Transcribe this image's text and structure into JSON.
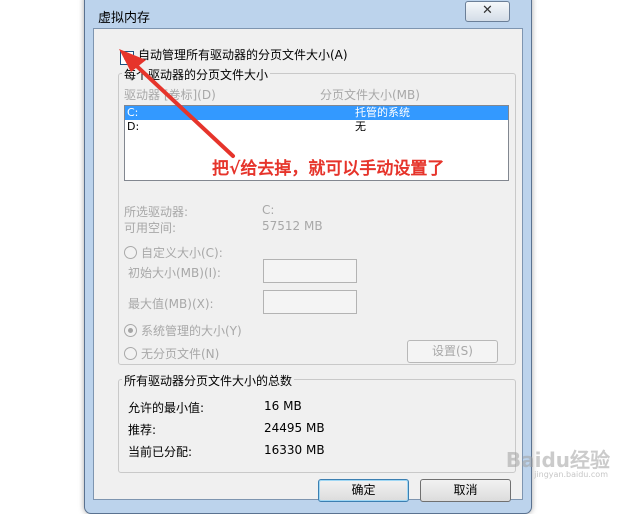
{
  "window": {
    "title": "虚拟内存",
    "close_glyph": "✕"
  },
  "auto_manage": {
    "label": "自动管理所有驱动器的分页文件大小(A)",
    "checked": true,
    "check_glyph": "✓"
  },
  "per_drive": {
    "group_title": "每个驱动器的分页文件大小",
    "col_drive": "驱动器 [卷标](D)",
    "col_size": "分页文件大小(MB)",
    "rows": [
      {
        "drive": "C:",
        "size": "托管的系统",
        "selected": true
      },
      {
        "drive": "D:",
        "size": "无",
        "selected": false
      }
    ],
    "selected_drive_label": "所选驱动器:",
    "selected_drive_value": "C:",
    "free_space_label": "可用空间:",
    "free_space_value": "57512 MB",
    "custom_size_label": "自定义大小(C):",
    "initial_size_label": "初始大小(MB)(I):",
    "max_size_label": "最大值(MB)(X):",
    "system_managed_label": "系统管理的大小(Y)",
    "no_paging_label": "无分页文件(N)",
    "set_button": "设置(S)"
  },
  "totals": {
    "group_title": "所有驱动器分页文件大小的总数",
    "min_label": "允许的最小值:",
    "min_value": "16 MB",
    "recommended_label": "推荐:",
    "recommended_value": "24495 MB",
    "current_label": "当前已分配:",
    "current_value": "16330 MB"
  },
  "buttons": {
    "ok": "确定",
    "cancel": "取消"
  },
  "annotation": {
    "text": "把√给去掉，就可以手动设置了",
    "color": "#e6342b"
  },
  "watermark": {
    "text": "Baidu经验",
    "sub": "jingyan.baidu.com"
  }
}
